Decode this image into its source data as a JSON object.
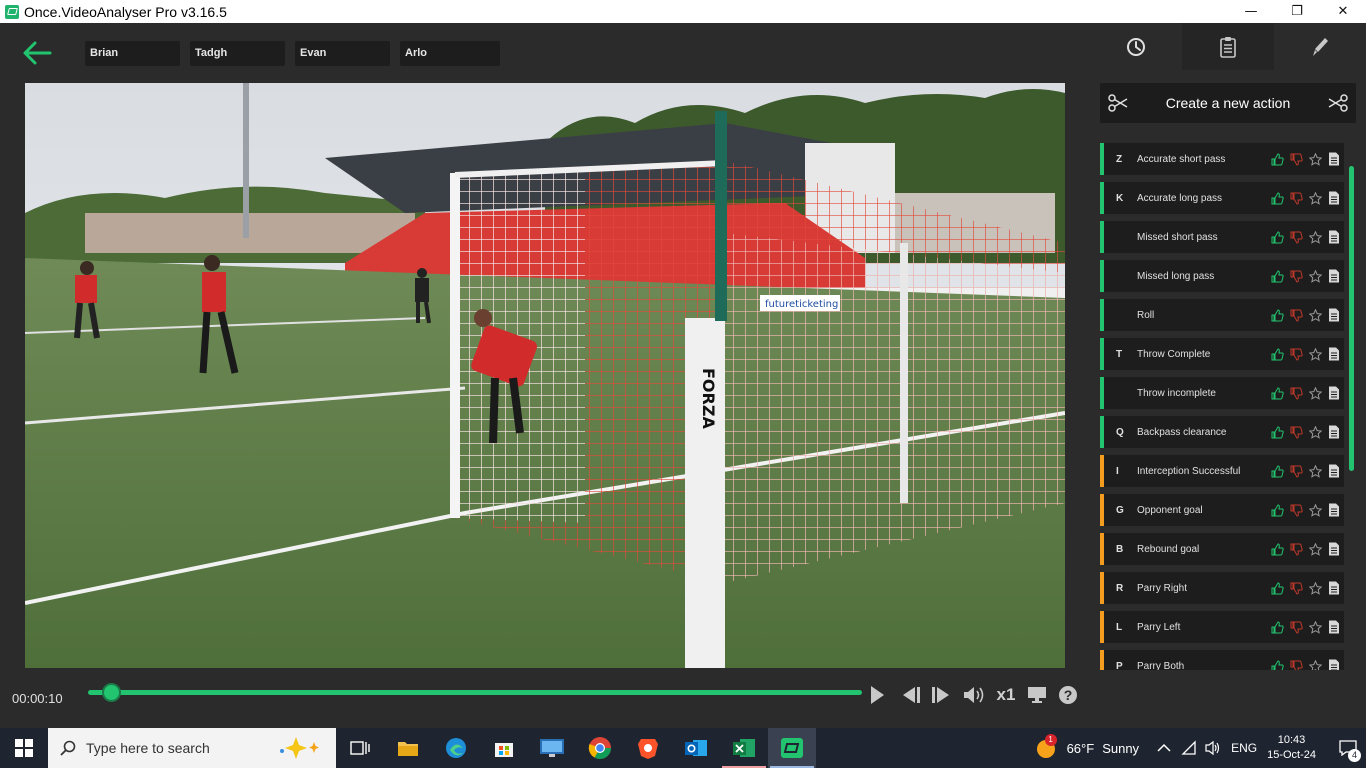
{
  "window": {
    "title": "Once.VideoAnalyser Pro v3.16.5",
    "minimize": "—",
    "maximize": "❐",
    "close": "✕"
  },
  "players": [
    "Brian",
    "Tadgh",
    "Evan",
    "Arlo"
  ],
  "panel": {
    "create_action": "Create a new action",
    "actions": [
      {
        "key": "Z",
        "name": "Accurate short pass",
        "color": "#22c46f"
      },
      {
        "key": "K",
        "name": "Accurate long pass",
        "color": "#22c46f"
      },
      {
        "key": "",
        "name": "Missed short pass",
        "color": "#22c46f"
      },
      {
        "key": "",
        "name": "Missed long pass",
        "color": "#22c46f"
      },
      {
        "key": "",
        "name": "Roll",
        "color": "#22c46f"
      },
      {
        "key": "T",
        "name": "Throw Complete",
        "color": "#22c46f"
      },
      {
        "key": "",
        "name": "Throw incomplete",
        "color": "#22c46f"
      },
      {
        "key": "Q",
        "name": "Backpass clearance",
        "color": "#22c46f"
      },
      {
        "key": "I",
        "name": "Interception Successful",
        "color": "#f39c1f"
      },
      {
        "key": "G",
        "name": "Opponent goal",
        "color": "#f39c1f"
      },
      {
        "key": "B",
        "name": "Rebound goal",
        "color": "#f39c1f"
      },
      {
        "key": "R",
        "name": "Parry Right",
        "color": "#f39c1f"
      },
      {
        "key": "L",
        "name": "Parry Left",
        "color": "#f39c1f"
      },
      {
        "key": "P",
        "name": "Parry Both",
        "color": "#f39c1f"
      }
    ]
  },
  "player": {
    "timecode": "00:00:10",
    "progress_fraction": 0.03,
    "speed": "x1",
    "help": "?"
  },
  "video": {
    "post_text": "FORZA",
    "banner_text": "futureticketing"
  },
  "taskbar": {
    "search_placeholder": "Type here to search",
    "weather_temp": "66°F",
    "weather_desc": "Sunny",
    "language": "ENG",
    "time": "10:43",
    "date": "15-Oct-24",
    "notification_count": "4",
    "weather_badge": "1"
  },
  "colors": {
    "accent": "#22c46f",
    "orange": "#f39c1f",
    "thumb_up": "#22c46f",
    "thumb_down": "#c0392b"
  }
}
